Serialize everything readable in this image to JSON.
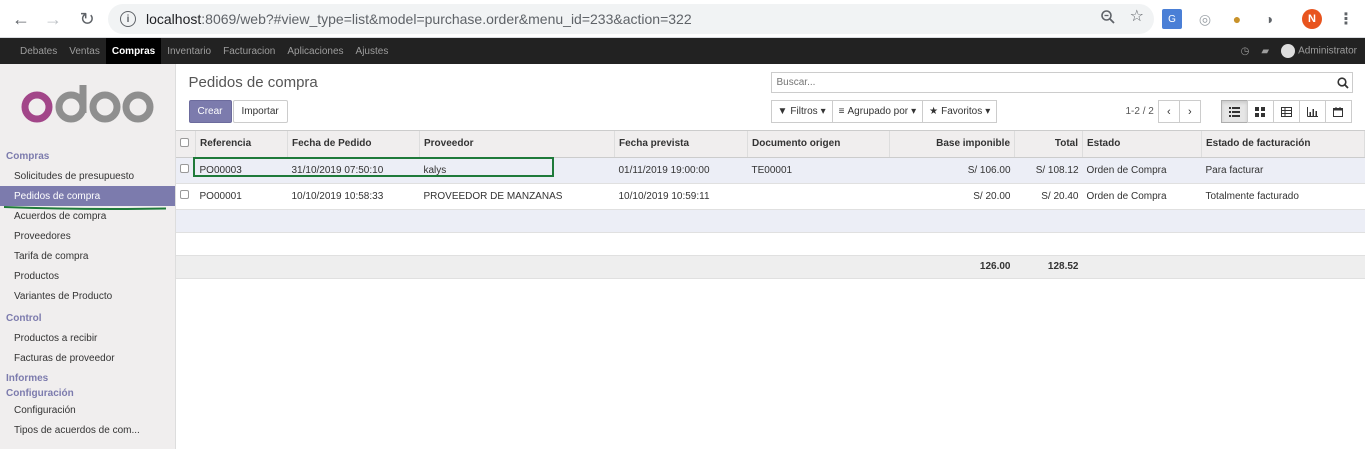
{
  "browser": {
    "url_host": "localhost",
    "url_rest": ":8069/web?#view_type=list&model=purchase.order&menu_id=233&action=322",
    "profile_initial": "N"
  },
  "topbar": {
    "menus": [
      "Debates",
      "Ventas",
      "Compras",
      "Inventario",
      "Facturacion",
      "Aplicaciones",
      "Ajustes"
    ],
    "active_menu": "Compras",
    "user": "Administrator"
  },
  "sidebar": {
    "sections": [
      {
        "title": "Compras",
        "items": [
          "Solicitudes de presupuesto",
          "Pedidos de compra",
          "Acuerdos de compra",
          "Proveedores",
          "Tarifa de compra",
          "Productos",
          "Variantes de Producto"
        ]
      },
      {
        "title": "Control",
        "items": [
          "Productos a recibir",
          "Facturas de proveedor"
        ]
      },
      {
        "title": "Informes",
        "items": []
      },
      {
        "title": "Configuración",
        "items": [
          "Configuración",
          "Tipos de acuerdos de com..."
        ]
      }
    ],
    "active_item": "Pedidos de compra"
  },
  "control_panel": {
    "title": "Pedidos de compra",
    "create_label": "Crear",
    "import_label": "Importar",
    "search_placeholder": "Buscar...",
    "filters_label": "Filtros",
    "group_label": "Agrupado por",
    "favorites_label": "Favoritos",
    "pager_value": "1-2 / 2"
  },
  "table": {
    "columns": [
      "Referencia",
      "Fecha de Pedido",
      "Proveedor",
      "Fecha prevista",
      "Documento origen",
      "Base imponible",
      "Total",
      "Estado",
      "Estado de facturación"
    ],
    "rows": [
      [
        "PO00003",
        "31/10/2019 07:50:10",
        "kalys",
        "01/11/2019 19:00:00",
        "TE00001",
        "S/ 106.00",
        "S/ 108.12",
        "Orden de Compra",
        "Para facturar"
      ],
      [
        "PO00001",
        "10/10/2019 10:58:33",
        "PROVEEDOR DE MANZANAS",
        "10/10/2019 10:59:11",
        "",
        "S/ 20.00",
        "S/ 20.40",
        "Orden de Compra",
        "Totalmente facturado"
      ]
    ],
    "totals": {
      "base": "126.00",
      "total": "128.52"
    }
  }
}
